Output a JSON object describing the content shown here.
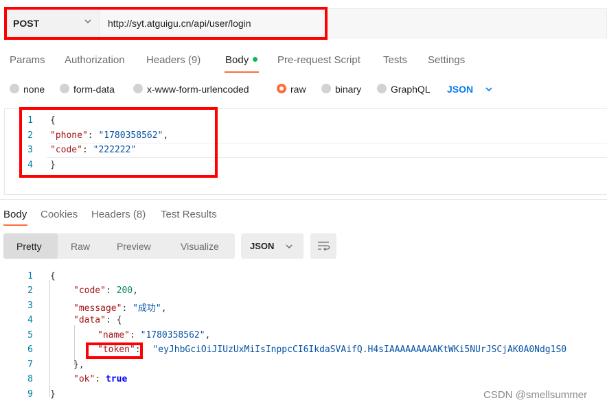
{
  "request": {
    "method": "POST",
    "url": "http://syt.atguigu.cn/api/user/login",
    "tabs": [
      "Params",
      "Authorization",
      "Headers (9)",
      "Body",
      "Pre-request Script",
      "Tests",
      "Settings"
    ],
    "body_types": [
      "none",
      "form-data",
      "x-www-form-urlencoded",
      "raw",
      "binary",
      "GraphQL"
    ],
    "body_format": "JSON",
    "body_line_numbers": [
      "1",
      "2",
      "3",
      "4"
    ],
    "body_lines": {
      "open": "{",
      "phone_key": "\"phone\"",
      "phone_value": "\"1780358562\"",
      "code_key": "\"code\"",
      "code_value": "\"222222\"",
      "close": "}"
    }
  },
  "response": {
    "tabs": [
      "Body",
      "Cookies",
      "Headers (8)",
      "Test Results"
    ],
    "views": [
      "Pretty",
      "Raw",
      "Preview",
      "Visualize"
    ],
    "format": "JSON",
    "line_numbers": [
      "1",
      "2",
      "3",
      "4",
      "5",
      "6",
      "7",
      "8",
      "9"
    ],
    "json": {
      "open": "{",
      "code_key": "\"code\"",
      "code_value": "200",
      "message_key": "\"message\"",
      "message_value": "\"成功\"",
      "data_key": "\"data\"",
      "data_open": "{",
      "name_key": "\"name\"",
      "name_value": "\"1780358562\"",
      "token_key": "\"token\"",
      "token_value": "\"eyJhbGciOiJIUzUxMiIsInppcCI6IkdaSVAifQ.H4sIAAAAAAAAAKtWKi5NUrJSCjAK0A0Ndg1S0",
      "data_close": "},",
      "ok_key": "\"ok\"",
      "ok_value": "true",
      "close": "}"
    }
  },
  "watermark": "CSDN @smellsummer",
  "colors": {
    "accent": "#ff6c37",
    "highlight_box": "#ff0000",
    "dot_green": "#0cbb52",
    "json_blue": "#097bed"
  }
}
